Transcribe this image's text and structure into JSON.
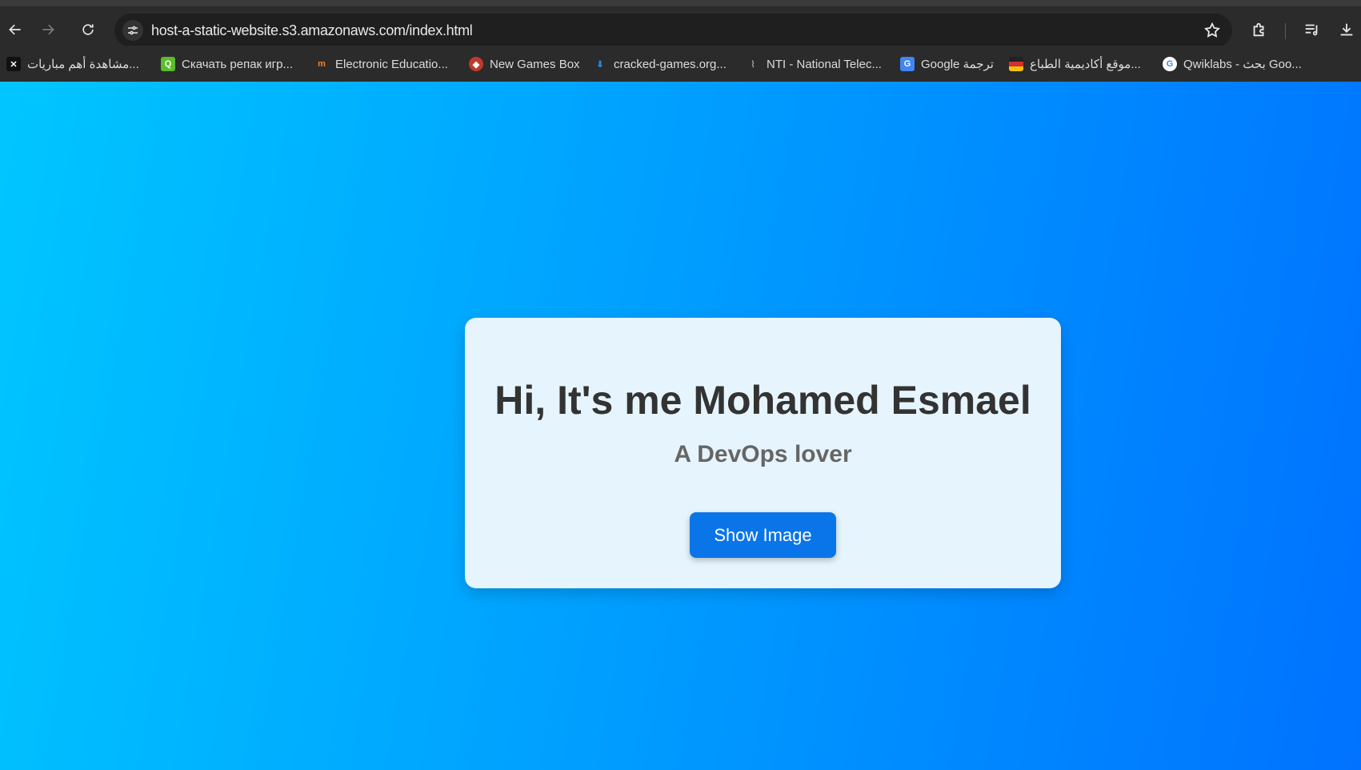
{
  "browser": {
    "url": "host-a-static-website.s3.amazonaws.com/index.html",
    "bookmarks": [
      {
        "label": "مشاهدة أهم مباريات...",
        "icon": "kooora-icon",
        "color": "#111111"
      },
      {
        "label": "Скачать репак игр...",
        "icon": "repack-icon",
        "color": "#5bbd2b"
      },
      {
        "label": "Electronic Educatio...",
        "icon": "moodle-icon",
        "color": "#f58220"
      },
      {
        "label": "New Games Box",
        "icon": "games-box-icon",
        "color": "#c0392b"
      },
      {
        "label": "cracked-games.org...",
        "icon": "download-icon",
        "color": "#1e88e5"
      },
      {
        "label": "NTI - National Telec...",
        "icon": "nti-icon",
        "color": "#9aa0a6"
      },
      {
        "label": "Google ترجمة",
        "icon": "google-translate-icon",
        "color": "#4285f4"
      },
      {
        "label": "موقع أكاديمية الطباع...",
        "icon": "academy-icon",
        "color": "#d32f2f"
      },
      {
        "label": "Qwiklabs - بحث Goo...",
        "icon": "google-icon",
        "color": "#ffffff"
      }
    ]
  },
  "page": {
    "heading": "Hi, It's me Mohamed Esmael",
    "subheading": "A DevOps lover",
    "button_label": "Show Image"
  }
}
